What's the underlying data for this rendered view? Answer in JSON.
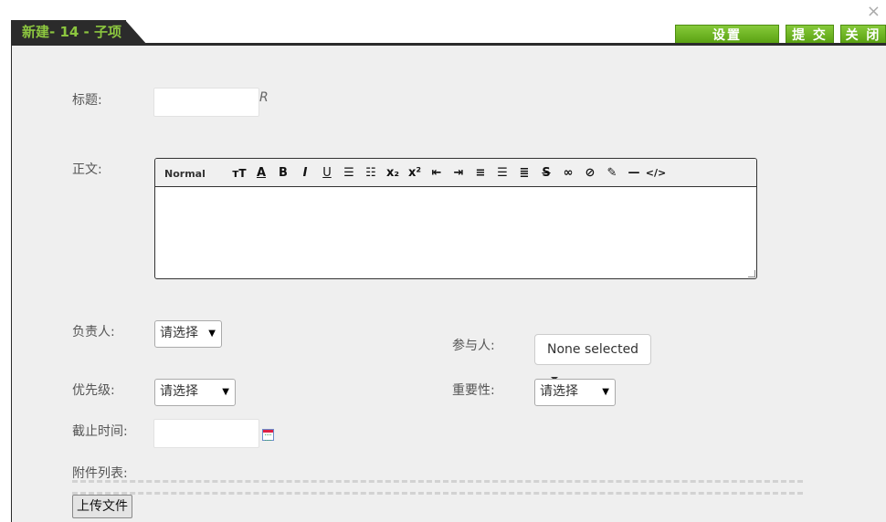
{
  "window": {
    "title": "新建- 14 - 子项",
    "close_glyph": "×"
  },
  "toolbar": {
    "settings_label": "设置",
    "submit_label": "提 交",
    "close_label": "关 闭"
  },
  "form": {
    "title_label": "标题:",
    "title_value": "",
    "title_suffix": "R",
    "body_label": "正文:",
    "editor": {
      "format_select": "Normal",
      "toolbar_icons": [
        "font-size-icon",
        "font-color-icon",
        "bold-icon",
        "italic-icon",
        "underline-icon",
        "ordered-list-icon",
        "unordered-list-icon",
        "subscript-icon",
        "superscript-icon",
        "outdent-icon",
        "indent-icon",
        "align-left-icon",
        "align-center-icon",
        "align-right-icon",
        "strikethrough-icon",
        "link-icon",
        "unlink-icon",
        "clear-format-icon",
        "horizontal-rule-icon",
        "code-view-icon"
      ],
      "content": ""
    },
    "owner_label": "负责人:",
    "owner_value": "请选择",
    "participants_label": "参与人:",
    "participants_value": "None selected",
    "priority_label": "优先级:",
    "priority_value": "请选择",
    "importance_label": "重要性:",
    "importance_value": "请选择",
    "deadline_label": "截止时间:",
    "deadline_value": "",
    "attachments_label": "附件列表:",
    "upload_label": "上传文件"
  },
  "colors": {
    "accent_green": "#6cb323",
    "title_tab_bg": "#2b2b2b",
    "title_text": "#8cc63f",
    "panel_bg": "#efefef"
  }
}
